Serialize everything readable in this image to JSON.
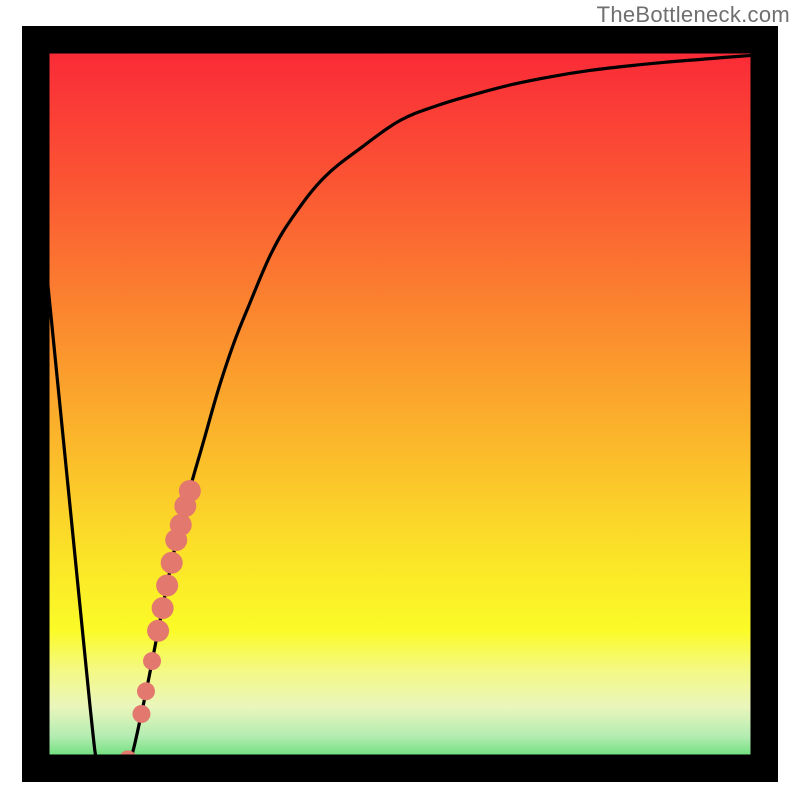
{
  "attribution": "TheBottleneck.com",
  "colors": {
    "gradient_stops": [
      {
        "offset": 0.0,
        "color": "#fa2238"
      },
      {
        "offset": 0.2,
        "color": "#fb5334"
      },
      {
        "offset": 0.4,
        "color": "#fb8c2e"
      },
      {
        "offset": 0.55,
        "color": "#fbb72b"
      },
      {
        "offset": 0.7,
        "color": "#fbe328"
      },
      {
        "offset": 0.8,
        "color": "#fbfb28"
      },
      {
        "offset": 0.85,
        "color": "#f4f980"
      },
      {
        "offset": 0.9,
        "color": "#eaf6bc"
      },
      {
        "offset": 0.94,
        "color": "#b3ecb1"
      },
      {
        "offset": 0.96,
        "color": "#7ee289"
      },
      {
        "offset": 0.98,
        "color": "#47d862"
      },
      {
        "offset": 1.0,
        "color": "#1fd24a"
      }
    ],
    "frame": "#000000",
    "curve": "#000000",
    "markers": "#e3796e"
  },
  "chart_data": {
    "type": "line",
    "title": "",
    "xlabel": "",
    "ylabel": "",
    "xlim": [
      0,
      100
    ],
    "ylim": [
      0,
      100
    ],
    "grid": false,
    "legend": false,
    "series": [
      {
        "name": "bottleneck-curve",
        "x": [
          0,
          5,
          7,
          9,
          10,
          11,
          12,
          14,
          16,
          18,
          20,
          22,
          24,
          26,
          28,
          30,
          33,
          36,
          40,
          45,
          50,
          55,
          60,
          65,
          70,
          75,
          80,
          85,
          90,
          95,
          100
        ],
        "y": [
          100,
          50,
          30,
          10,
          2,
          1,
          1,
          2,
          10,
          20,
          30,
          38,
          45,
          52,
          58,
          63,
          70,
          75,
          80,
          84,
          87.5,
          89.5,
          91,
          92.3,
          93.3,
          94.1,
          94.7,
          95.2,
          95.6,
          96,
          96.3
        ]
      }
    ],
    "markers": {
      "name": "highlighted-points",
      "points": [
        {
          "x": 14.0,
          "y": 3
        },
        {
          "x": 15.8,
          "y": 9
        },
        {
          "x": 16.4,
          "y": 12
        },
        {
          "x": 17.2,
          "y": 16
        },
        {
          "x": 18.0,
          "y": 20
        },
        {
          "x": 18.6,
          "y": 23
        },
        {
          "x": 19.2,
          "y": 26
        },
        {
          "x": 19.8,
          "y": 29
        },
        {
          "x": 20.4,
          "y": 32
        },
        {
          "x": 21.0,
          "y": 34
        },
        {
          "x": 21.6,
          "y": 36.5
        },
        {
          "x": 22.2,
          "y": 38.5
        }
      ]
    }
  }
}
